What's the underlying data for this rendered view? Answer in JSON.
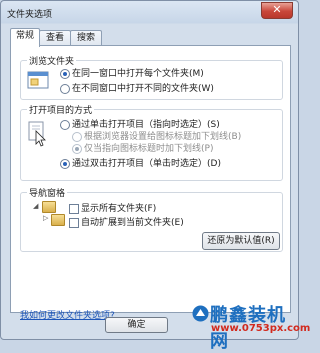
{
  "window": {
    "title": "文件夹选项",
    "close_label": "✕"
  },
  "tabs": [
    {
      "label": "常规",
      "active": true
    },
    {
      "label": "查看",
      "active": false
    },
    {
      "label": "搜索",
      "active": false
    }
  ],
  "browse_folders": {
    "title": "浏览文件夹",
    "options": [
      {
        "label": "在同一窗口中打开每个文件夹",
        "shortcut": "(M)",
        "selected": true
      },
      {
        "label": "在不同窗口中打开不同的文件夹",
        "shortcut": "(W)",
        "selected": false
      }
    ]
  },
  "click_items": {
    "title": "打开项目的方式",
    "single_click": {
      "label": "通过单击打开项目（指向时选定）",
      "shortcut": "(S)",
      "selected": false
    },
    "sub_options": [
      {
        "label": "根据浏览器设置给图标标题加下划线",
        "shortcut": "(B)",
        "selected": false
      },
      {
        "label": "仅当指向图标标题时加下划线",
        "shortcut": "(P)",
        "selected": true
      }
    ],
    "double_click": {
      "label": "通过双击打开项目（单击时选定）",
      "shortcut": "(D)",
      "selected": true
    }
  },
  "navigation_pane": {
    "title": "导航窗格",
    "checkboxes": [
      {
        "label": "显示所有文件夹",
        "shortcut": "(F)",
        "checked": false
      },
      {
        "label": "自动扩展到当前文件夹",
        "shortcut": "(E)",
        "checked": false
      }
    ]
  },
  "restore_defaults_label": "还原为默认值(R)",
  "help_link": "我如何更改文件夹选项?",
  "ok_label": "确定",
  "watermark": {
    "brand": "鹏鑫装机网",
    "url": "www.0753px.com"
  }
}
